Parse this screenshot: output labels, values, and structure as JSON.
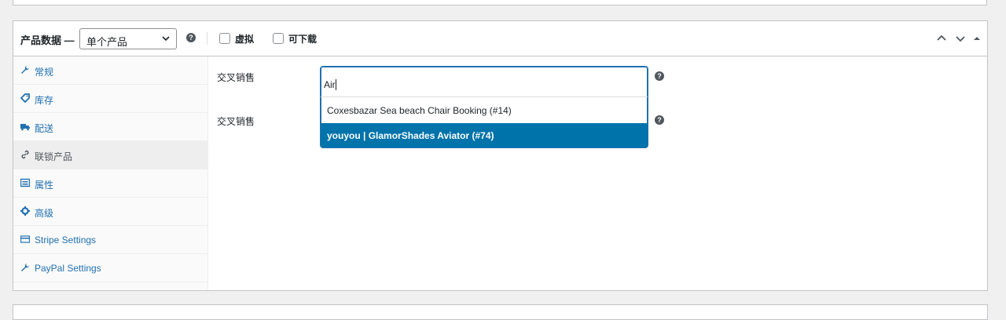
{
  "panel": {
    "title": "产品数据 —",
    "product_type": {
      "selected": "单个产品"
    },
    "virtual_label": "虚拟",
    "downloadable_label": "可下载",
    "help_glyph": "?"
  },
  "sidebar": {
    "items": [
      {
        "label": "常规",
        "icon": "wrench-icon"
      },
      {
        "label": "库存",
        "icon": "tag-icon"
      },
      {
        "label": "配送",
        "icon": "truck-icon"
      },
      {
        "label": "联锁产品",
        "icon": "link-icon",
        "active": true
      },
      {
        "label": "属性",
        "icon": "list-icon"
      },
      {
        "label": "高级",
        "icon": "gear-icon"
      },
      {
        "label": "Stripe Settings",
        "icon": "card-icon"
      },
      {
        "label": "PayPal Settings",
        "icon": "wrench-icon"
      }
    ]
  },
  "fields": {
    "field1_label": "交叉销售",
    "field2_label": "交叉销售"
  },
  "dropdown": {
    "search_value": "Air",
    "options": [
      {
        "label": "Coxesbazar Sea beach Chair Booking (#14)"
      },
      {
        "label": "youyou | GlamorShades Aviator (#74)",
        "highlighted": true
      }
    ]
  },
  "colors": {
    "accent": "#2271b1",
    "highlight": "#0073aa",
    "border": "#c3c4c7",
    "background": "#f0f0f1"
  }
}
